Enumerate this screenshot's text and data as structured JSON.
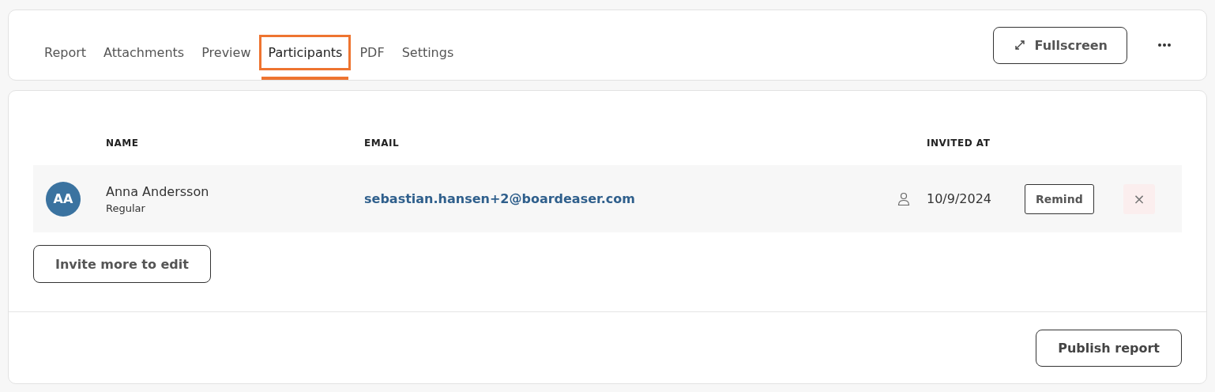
{
  "tabs": [
    {
      "label": "Report",
      "selected": false
    },
    {
      "label": "Attachments",
      "selected": false
    },
    {
      "label": "Preview",
      "selected": false
    },
    {
      "label": "Participants",
      "selected": true
    },
    {
      "label": "PDF",
      "selected": false
    },
    {
      "label": "Settings",
      "selected": false
    }
  ],
  "fullscreen_button": "Fullscreen",
  "table": {
    "columns": [
      "NAME",
      "EMAIL",
      "INVITED AT"
    ],
    "rows": [
      {
        "initials": "AA",
        "name": "Anna Andersson",
        "role": "Regular",
        "email": "sebastian.hansen+2@boardeaser.com",
        "invited_at": "10/9/2024",
        "remind": "Remind",
        "remove": "×"
      }
    ]
  },
  "invite_button": "Invite more to edit",
  "publish_button": "Publish report"
}
